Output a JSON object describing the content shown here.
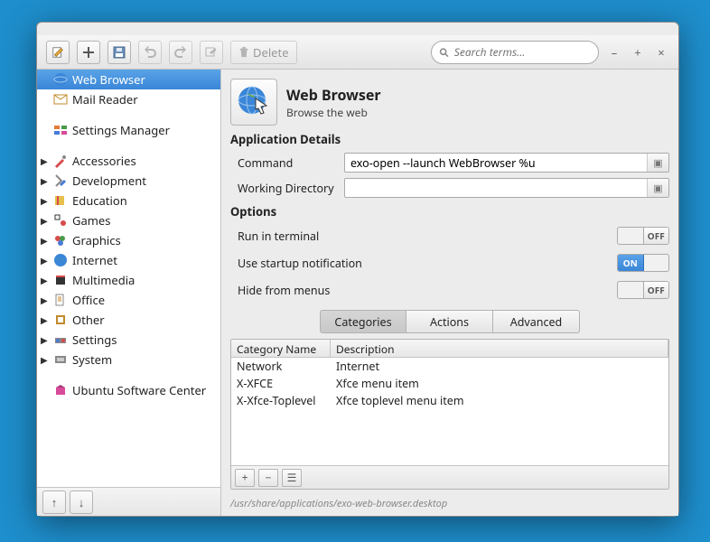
{
  "toolbar": {
    "delete_label": "Delete",
    "search_placeholder": "Search terms..."
  },
  "sidebar": {
    "items": [
      {
        "label": "Web Browser",
        "icon": "globe",
        "expandable": false,
        "selected": true
      },
      {
        "label": "Mail Reader",
        "icon": "mail",
        "expandable": false
      },
      {
        "sep": true
      },
      {
        "label": "Settings Manager",
        "icon": "settings",
        "expandable": false
      },
      {
        "sep": true
      },
      {
        "label": "Accessories",
        "icon": "accessories",
        "expandable": true
      },
      {
        "label": "Development",
        "icon": "development",
        "expandable": true
      },
      {
        "label": "Education",
        "icon": "education",
        "expandable": true
      },
      {
        "label": "Games",
        "icon": "games",
        "expandable": true
      },
      {
        "label": "Graphics",
        "icon": "graphics",
        "expandable": true
      },
      {
        "label": "Internet",
        "icon": "internet",
        "expandable": true
      },
      {
        "label": "Multimedia",
        "icon": "multimedia",
        "expandable": true
      },
      {
        "label": "Office",
        "icon": "office",
        "expandable": true
      },
      {
        "label": "Other",
        "icon": "other",
        "expandable": true
      },
      {
        "label": "Settings",
        "icon": "settings-cat",
        "expandable": true
      },
      {
        "label": "System",
        "icon": "system",
        "expandable": true
      },
      {
        "sep": true
      },
      {
        "label": "Ubuntu Software Center",
        "icon": "usc",
        "expandable": false
      }
    ]
  },
  "app": {
    "title": "Web Browser",
    "subtitle": "Browse the web"
  },
  "details": {
    "section": "Application Details",
    "command_label": "Command",
    "command_value": "exo-open --launch WebBrowser %u",
    "wd_label": "Working Directory",
    "wd_value": ""
  },
  "options": {
    "section": "Options",
    "run_terminal": {
      "label": "Run in terminal",
      "on": false
    },
    "startup_notif": {
      "label": "Use startup notification",
      "on": true
    },
    "hide_menus": {
      "label": "Hide from menus",
      "on": false
    },
    "on_text": "ON",
    "off_text": "OFF"
  },
  "tabs": {
    "categories": "Categories",
    "actions": "Actions",
    "advanced": "Advanced"
  },
  "cat_table": {
    "col_name": "Category Name",
    "col_desc": "Description",
    "rows": [
      {
        "name": "Network",
        "desc": "Internet"
      },
      {
        "name": "X-XFCE",
        "desc": "Xfce menu item"
      },
      {
        "name": "X-Xfce-Toplevel",
        "desc": "Xfce toplevel menu item"
      }
    ]
  },
  "path": "/usr/share/applications/exo-web-browser.desktop"
}
